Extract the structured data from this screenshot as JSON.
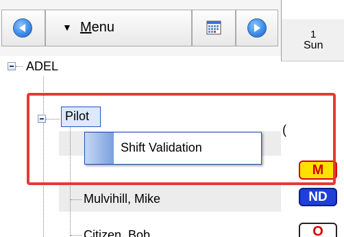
{
  "toolbar": {
    "menu_label_first": "M",
    "menu_label_rest": "enu",
    "prev_icon": "arrow-left-circle-icon",
    "next_icon": "arrow-right-circle-icon",
    "calendar_icon": "calendar-icon"
  },
  "day_header": {
    "day_number": "1",
    "day_name": "Sun"
  },
  "tree": {
    "root_label": "ADEL",
    "group_label": "Pilot",
    "person_1": "Mulvihill, Mike",
    "person_2_partial": "Citizen, Bob"
  },
  "context_menu": {
    "item_label": "Shift Validation"
  },
  "cells": {
    "row_1_code": "M",
    "row_2_code": "ND",
    "row_3_code": "O",
    "row_0_partial": "("
  },
  "colors": {
    "highlight": "#e53935",
    "selection_border": "#1e50c8",
    "nd_badge": "#1e3fd8",
    "m_badge": "#ffe100"
  }
}
